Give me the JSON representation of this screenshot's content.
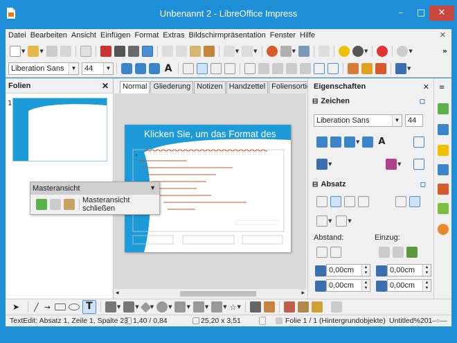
{
  "window": {
    "title": "Unbenannt 2 - LibreOffice Impress",
    "min": "–",
    "max": "□",
    "close": "✕"
  },
  "menu": {
    "items": [
      "Datei",
      "Bearbeiten",
      "Ansicht",
      "Einfügen",
      "Format",
      "Extras",
      "Bildschirmpräsentation",
      "Fenster",
      "Hilfe"
    ],
    "close": "✕"
  },
  "format_toolbar": {
    "font_name": "Liberation Sans",
    "font_size": "44"
  },
  "slides_pane": {
    "title": "Folien",
    "close": "✕",
    "thumb_number": "1"
  },
  "tabs": [
    "Normal",
    "Gliederung",
    "Notizen",
    "Handzettel",
    "Foliensortierung"
  ],
  "slide": {
    "title_placeholder": "Klicken Sie, um das Format des",
    "bullet": "•"
  },
  "sidebar": {
    "title": "Eigenschaften",
    "close": "✕",
    "char_section": "Zeichen",
    "char_font": "Liberation Sans",
    "char_size": "44",
    "para_section": "Absatz",
    "spacing_label": "Abstand:",
    "indent_label": "Einzug:",
    "spacing_above": "0,00cm",
    "spacing_below": "0,00cm",
    "indent_before": "0,00cm",
    "indent_after": "0,00cm"
  },
  "master_toolbar": {
    "title": "Masteransicht",
    "close_label": "Masteransicht schließen"
  },
  "status": {
    "edit": "TextEdit: Absatz 1, Zeile 1, Spalte 23",
    "position": "1,40 / 0,84",
    "size": "25,20 x 3,51",
    "slide": "Folie 1 / 1 (Hintergrundobjekte)",
    "master": "Untitled%201"
  },
  "colors": {
    "titlebar": "#1e8fd6",
    "close_btn": "#c9483e",
    "slide_blue": "#1d9ad8",
    "redline": "#d9502a"
  }
}
